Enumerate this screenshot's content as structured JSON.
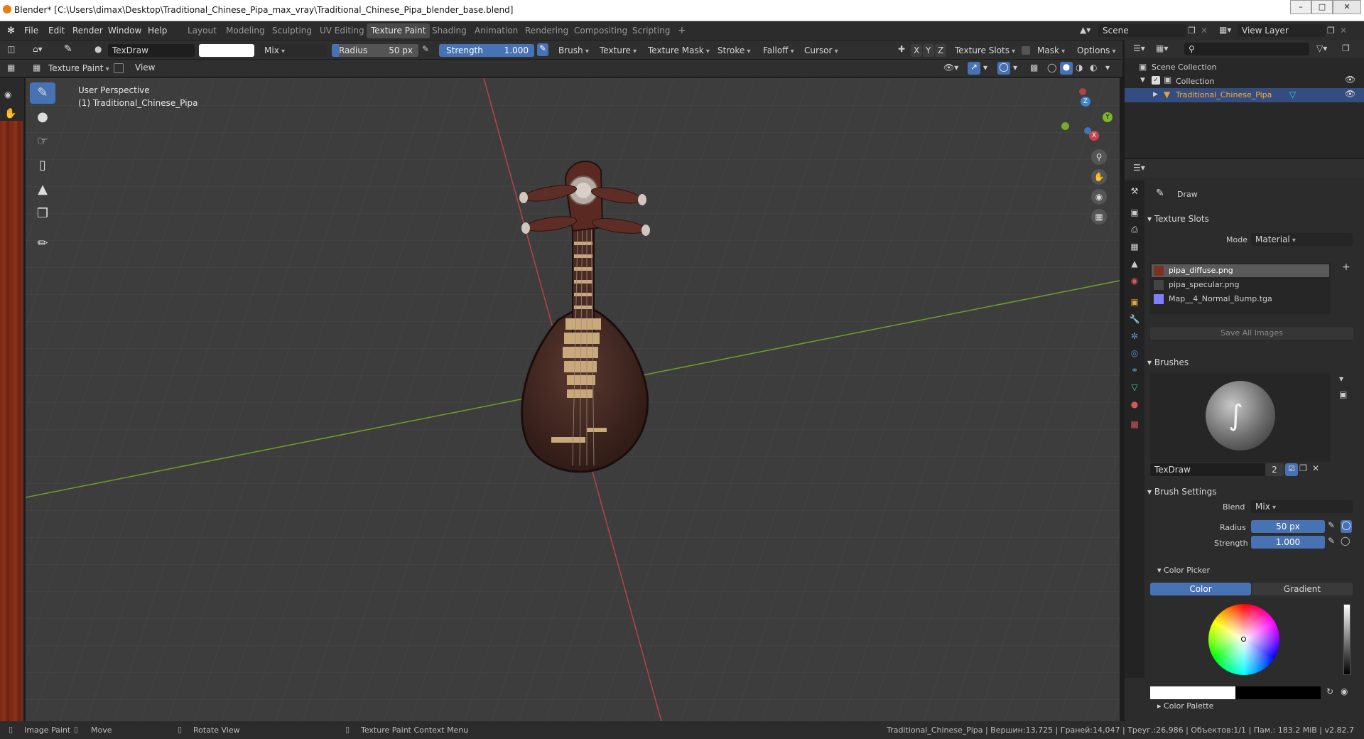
{
  "window": {
    "title": "Blender* [C:\\Users\\dimax\\Desktop\\Traditional_Chinese_Pipa_max_vray\\Traditional_Chinese_Pipa_blender_base.blend]"
  },
  "menu": [
    "File",
    "Edit",
    "Render",
    "Window",
    "Help"
  ],
  "workspaces": [
    "Layout",
    "Modeling",
    "Sculpting",
    "UV Editing",
    "Texture Paint",
    "Shading",
    "Animation",
    "Rendering",
    "Compositing",
    "Scripting"
  ],
  "active_workspace": "Texture Paint",
  "scene": {
    "label": "Scene",
    "view_layer": "View Layer"
  },
  "tool_header": {
    "brush_name": "TexDraw",
    "blend": "Mix",
    "radius_label": "Radius",
    "radius_value": "50 px",
    "strength_label": "Strength",
    "strength_value": "1.000",
    "menus": [
      "Brush",
      "Texture",
      "Texture Mask",
      "Stroke",
      "Falloff",
      "Cursor"
    ],
    "axes": [
      "X",
      "Y",
      "Z"
    ],
    "texture_slots": "Texture Slots",
    "mask": "Mask",
    "options": "Options"
  },
  "editor_header": {
    "mode": "Texture Paint",
    "view": "View"
  },
  "viewport": {
    "perspective": "User Perspective",
    "object": "(1) Traditional_Chinese_Pipa"
  },
  "gizmo": {
    "x": "X",
    "y": "Y",
    "z": "Z"
  },
  "outliner": {
    "scene_collection": "Scene Collection",
    "collection": "Collection",
    "object": "Traditional_Chinese_Pipa"
  },
  "properties": {
    "active_tool": "Draw",
    "texture_slots_panel": "Texture Slots",
    "mode_label": "Mode",
    "mode_value": "Material",
    "slots": [
      "pipa_diffuse.png",
      "pipa_specular.png",
      "Map__4_Normal_Bump.tga"
    ],
    "save_all": "Save All Images",
    "brushes_panel": "Brushes",
    "brush_name": "TexDraw",
    "brush_users": "2",
    "brush_settings_panel": "Brush Settings",
    "blend_label": "Blend",
    "blend_value": "Mix",
    "radius_label": "Radius",
    "radius_value": "50 px",
    "strength_label": "Strength",
    "strength_value": "1.000",
    "color_picker_panel": "Color Picker",
    "color_tab": "Color",
    "gradient_tab": "Gradient",
    "color_palette_panel": "Color Palette"
  },
  "status": {
    "image_paint": "Image Paint",
    "move": "Move",
    "rotate": "Rotate View",
    "context_menu": "Texture Paint Context Menu",
    "stats": "Traditional_Chinese_Pipa | Вершин:13,725 | Граней:14,047 | Треуг.:26,986 | Объектов:1/1 | Пам.: 183.2 MiB | v2.82.7"
  },
  "colors": {
    "accent": "#4772b3",
    "x_axis": "#c8454b",
    "y_axis": "#7fb52b",
    "z_axis": "#3d83d4",
    "pipa_wood": "#3e2520",
    "frets": "#c9a97c"
  }
}
